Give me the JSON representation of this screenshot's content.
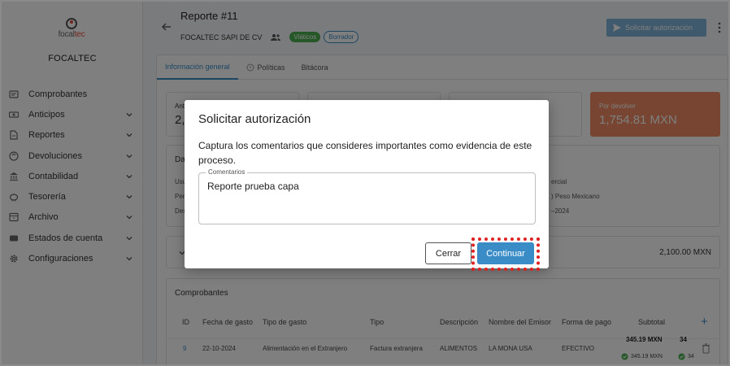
{
  "sidebar": {
    "logo_text_a": "focal",
    "logo_text_b": "tec",
    "company": "FOCALTEC",
    "items": [
      {
        "label": "Comprobantes",
        "icon": "receipt-icon",
        "expandable": false
      },
      {
        "label": "Anticipos",
        "icon": "cash-icon",
        "expandable": true
      },
      {
        "label": "Reportes",
        "icon": "document-icon",
        "expandable": true
      },
      {
        "label": "Devoluciones",
        "icon": "return-icon",
        "expandable": true
      },
      {
        "label": "Contabilidad",
        "icon": "bank-icon",
        "expandable": true
      },
      {
        "label": "Tesorería",
        "icon": "piggy-bank-icon",
        "expandable": true
      },
      {
        "label": "Archivo",
        "icon": "archive-icon",
        "expandable": true
      },
      {
        "label": "Estados de cuenta",
        "icon": "wallet-icon",
        "expandable": true
      },
      {
        "label": "Configuraciones",
        "icon": "gear-icon",
        "expandable": true
      }
    ]
  },
  "header": {
    "title": "Reporte #11",
    "company": "FOCALTEC SAPI DE CV",
    "chip_type": "Viáticos",
    "chip_status": "Borrador",
    "action_button": "Solicitar autorización"
  },
  "tabs": [
    {
      "label": "Información general",
      "active": true
    },
    {
      "label": "Políticas",
      "active": false
    },
    {
      "label": "Bitácora",
      "active": false
    }
  ],
  "stats": {
    "first_label_partial": "Ant",
    "first_value_partial": "2,",
    "devolver_label": "Por devolver",
    "devolver_value": "1,754.81 MXN"
  },
  "details": {
    "header_partial": "Da",
    "row_labels_partial": [
      "Usu",
      "Per",
      "Des"
    ],
    "right_values_partial": [
      "ercial",
      ") Peso Mexicano",
      "–2024"
    ]
  },
  "summary_total": "2,100.00 MXN",
  "comprobantes": {
    "title": "Comprobantes",
    "columns": [
      "ID",
      "Fecha de gasto",
      "Tipo de gasto",
      "Tipo",
      "Descripción",
      "Nombre del Emisor",
      "Forma de pago",
      "Subtotal"
    ],
    "rows": [
      {
        "id": "9",
        "fecha": "22-10-2024",
        "tipo_gasto": "Alimentación en el Extranjero",
        "tipo": "Factura extranjera",
        "descripcion": "ALIMENTOS",
        "emisor": "LA MONA USA",
        "forma_pago": "EFECTIVO",
        "subtotal": "345.19 MXN",
        "subtotal_sub": "345.19 MXN",
        "next_col_partial": "34",
        "next_col_sub_partial": "34"
      }
    ]
  },
  "dialog": {
    "title": "Solicitar autorización",
    "text": "Captura los comentarios que consideres importantes como evidencia de este proceso.",
    "field_label": "Comentarios",
    "field_value": "Reporte prueba capa",
    "cancel": "Cerrar",
    "confirm": "Continuar"
  },
  "colors": {
    "accent": "#3a8cc7",
    "orange": "#ee8a62",
    "green": "#4caf50",
    "highlight": "#e02020"
  }
}
